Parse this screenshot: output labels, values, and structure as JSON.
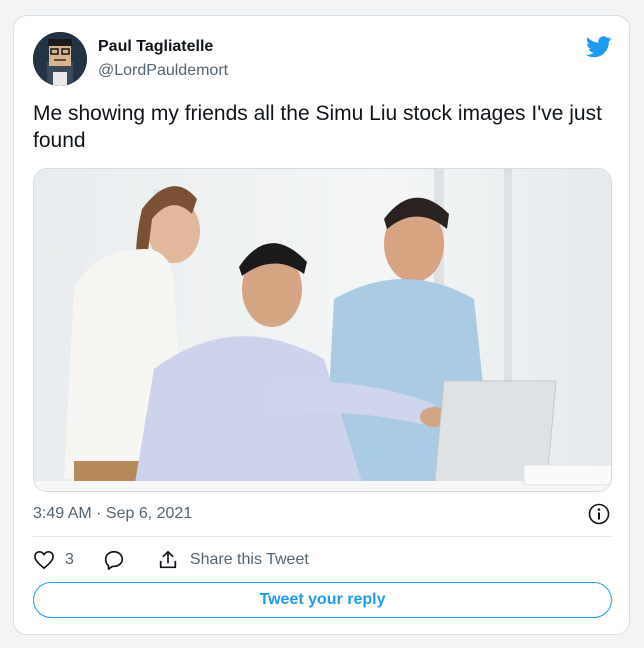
{
  "author": {
    "display_name": "Paul Tagliatelle",
    "handle": "@LordPauldemort"
  },
  "tweet": {
    "text": "Me showing my friends all the Simu Liu stock images I've just found",
    "timestamp": "3:49 AM · Sep 6, 2021"
  },
  "actions": {
    "like_count": "3",
    "share_label": "Share this Tweet"
  },
  "reply_button_label": "Tweet your reply",
  "colors": {
    "accent": "#1d9bf0",
    "text_primary": "#0f1419",
    "text_secondary": "#536471"
  },
  "icons": [
    "twitter-bird-icon",
    "info-icon",
    "heart-icon",
    "reply-bubble-icon",
    "share-icon"
  ]
}
